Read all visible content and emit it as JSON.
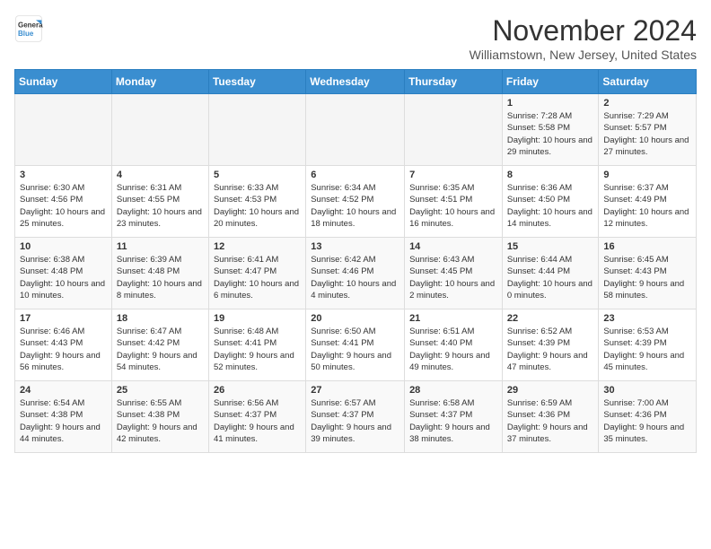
{
  "logo": {
    "general": "General",
    "blue": "Blue"
  },
  "header": {
    "month": "November 2024",
    "location": "Williamstown, New Jersey, United States"
  },
  "weekdays": [
    "Sunday",
    "Monday",
    "Tuesday",
    "Wednesday",
    "Thursday",
    "Friday",
    "Saturday"
  ],
  "weeks": [
    [
      {
        "day": "",
        "info": ""
      },
      {
        "day": "",
        "info": ""
      },
      {
        "day": "",
        "info": ""
      },
      {
        "day": "",
        "info": ""
      },
      {
        "day": "",
        "info": ""
      },
      {
        "day": "1",
        "info": "Sunrise: 7:28 AM\nSunset: 5:58 PM\nDaylight: 10 hours and 29 minutes."
      },
      {
        "day": "2",
        "info": "Sunrise: 7:29 AM\nSunset: 5:57 PM\nDaylight: 10 hours and 27 minutes."
      }
    ],
    [
      {
        "day": "3",
        "info": "Sunrise: 6:30 AM\nSunset: 4:56 PM\nDaylight: 10 hours and 25 minutes."
      },
      {
        "day": "4",
        "info": "Sunrise: 6:31 AM\nSunset: 4:55 PM\nDaylight: 10 hours and 23 minutes."
      },
      {
        "day": "5",
        "info": "Sunrise: 6:33 AM\nSunset: 4:53 PM\nDaylight: 10 hours and 20 minutes."
      },
      {
        "day": "6",
        "info": "Sunrise: 6:34 AM\nSunset: 4:52 PM\nDaylight: 10 hours and 18 minutes."
      },
      {
        "day": "7",
        "info": "Sunrise: 6:35 AM\nSunset: 4:51 PM\nDaylight: 10 hours and 16 minutes."
      },
      {
        "day": "8",
        "info": "Sunrise: 6:36 AM\nSunset: 4:50 PM\nDaylight: 10 hours and 14 minutes."
      },
      {
        "day": "9",
        "info": "Sunrise: 6:37 AM\nSunset: 4:49 PM\nDaylight: 10 hours and 12 minutes."
      }
    ],
    [
      {
        "day": "10",
        "info": "Sunrise: 6:38 AM\nSunset: 4:48 PM\nDaylight: 10 hours and 10 minutes."
      },
      {
        "day": "11",
        "info": "Sunrise: 6:39 AM\nSunset: 4:48 PM\nDaylight: 10 hours and 8 minutes."
      },
      {
        "day": "12",
        "info": "Sunrise: 6:41 AM\nSunset: 4:47 PM\nDaylight: 10 hours and 6 minutes."
      },
      {
        "day": "13",
        "info": "Sunrise: 6:42 AM\nSunset: 4:46 PM\nDaylight: 10 hours and 4 minutes."
      },
      {
        "day": "14",
        "info": "Sunrise: 6:43 AM\nSunset: 4:45 PM\nDaylight: 10 hours and 2 minutes."
      },
      {
        "day": "15",
        "info": "Sunrise: 6:44 AM\nSunset: 4:44 PM\nDaylight: 10 hours and 0 minutes."
      },
      {
        "day": "16",
        "info": "Sunrise: 6:45 AM\nSunset: 4:43 PM\nDaylight: 9 hours and 58 minutes."
      }
    ],
    [
      {
        "day": "17",
        "info": "Sunrise: 6:46 AM\nSunset: 4:43 PM\nDaylight: 9 hours and 56 minutes."
      },
      {
        "day": "18",
        "info": "Sunrise: 6:47 AM\nSunset: 4:42 PM\nDaylight: 9 hours and 54 minutes."
      },
      {
        "day": "19",
        "info": "Sunrise: 6:48 AM\nSunset: 4:41 PM\nDaylight: 9 hours and 52 minutes."
      },
      {
        "day": "20",
        "info": "Sunrise: 6:50 AM\nSunset: 4:41 PM\nDaylight: 9 hours and 50 minutes."
      },
      {
        "day": "21",
        "info": "Sunrise: 6:51 AM\nSunset: 4:40 PM\nDaylight: 9 hours and 49 minutes."
      },
      {
        "day": "22",
        "info": "Sunrise: 6:52 AM\nSunset: 4:39 PM\nDaylight: 9 hours and 47 minutes."
      },
      {
        "day": "23",
        "info": "Sunrise: 6:53 AM\nSunset: 4:39 PM\nDaylight: 9 hours and 45 minutes."
      }
    ],
    [
      {
        "day": "24",
        "info": "Sunrise: 6:54 AM\nSunset: 4:38 PM\nDaylight: 9 hours and 44 minutes."
      },
      {
        "day": "25",
        "info": "Sunrise: 6:55 AM\nSunset: 4:38 PM\nDaylight: 9 hours and 42 minutes."
      },
      {
        "day": "26",
        "info": "Sunrise: 6:56 AM\nSunset: 4:37 PM\nDaylight: 9 hours and 41 minutes."
      },
      {
        "day": "27",
        "info": "Sunrise: 6:57 AM\nSunset: 4:37 PM\nDaylight: 9 hours and 39 minutes."
      },
      {
        "day": "28",
        "info": "Sunrise: 6:58 AM\nSunset: 4:37 PM\nDaylight: 9 hours and 38 minutes."
      },
      {
        "day": "29",
        "info": "Sunrise: 6:59 AM\nSunset: 4:36 PM\nDaylight: 9 hours and 37 minutes."
      },
      {
        "day": "30",
        "info": "Sunrise: 7:00 AM\nSunset: 4:36 PM\nDaylight: 9 hours and 35 minutes."
      }
    ]
  ]
}
